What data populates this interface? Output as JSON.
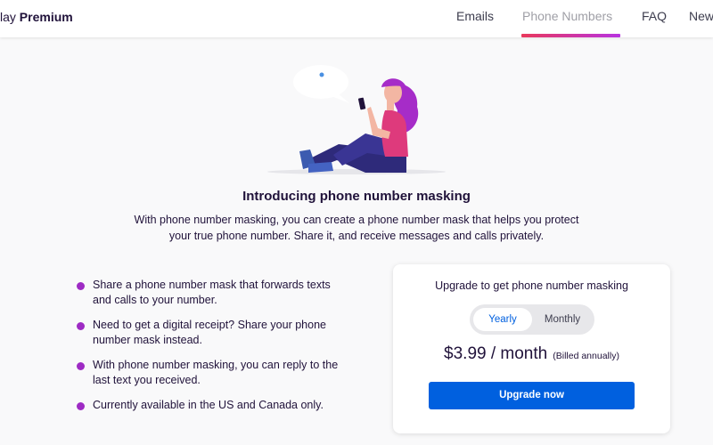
{
  "header": {
    "brand_prefix": "lay",
    "brand_bold": "Premium",
    "nav": [
      {
        "label": "Emails",
        "active": false
      },
      {
        "label": "Phone Numbers",
        "active": true
      },
      {
        "label": "FAQ",
        "active": false
      },
      {
        "label": "New",
        "active": false
      }
    ],
    "accent_gradient": [
      "#e9385c",
      "#b833e1"
    ]
  },
  "hero": {
    "illustration": "person-sitting-with-phone-illustration",
    "speech_bubble": "speech-bubble-icon"
  },
  "intro": {
    "headline": "Introducing phone number masking",
    "subtext": "With phone number masking, you can create a phone number mask that helps you protect your true phone number. Share it, and receive messages and calls privately."
  },
  "features": [
    "Share a phone number mask that forwards texts and calls to your number.",
    "Need to get a digital receipt? Share your phone number mask instead.",
    "With phone number masking, you can reply to the last text you received.",
    "Currently available in the US and Canada only."
  ],
  "plan_card": {
    "title": "Upgrade to get phone number masking",
    "toggle": {
      "options": [
        "Yearly",
        "Monthly"
      ],
      "selected": "Yearly"
    },
    "price": "$3.99 / month",
    "billing_note": "(Billed annually)",
    "cta": "Upgrade now",
    "cta_color": "#0060df"
  },
  "colors": {
    "bullet": "#9e2bc4",
    "text": "#20123a"
  }
}
